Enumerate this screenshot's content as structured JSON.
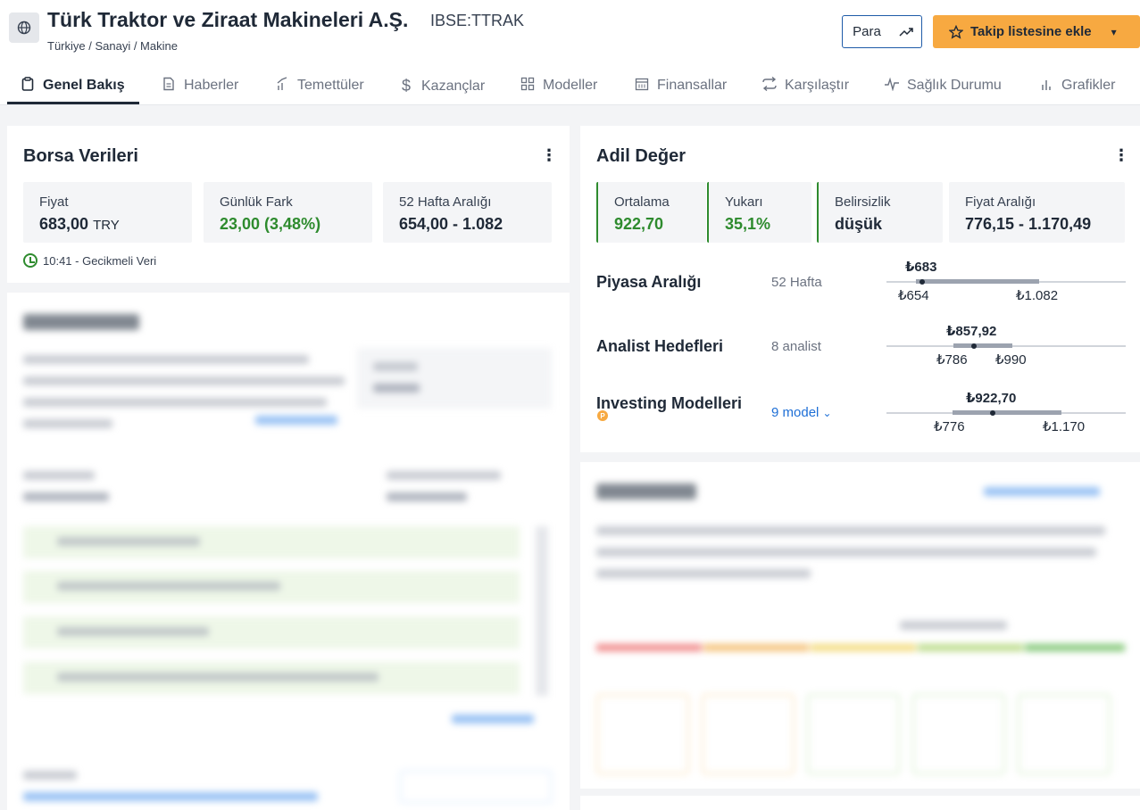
{
  "header": {
    "title": "Türk Traktor ve Ziraat Makineleri A.Ş.",
    "ticker": "IBSE:TTRAK",
    "breadcrumb": "Türkiye / Sanayi / Makine",
    "para_label": "Para",
    "watch_label": "Takip listesine ekle"
  },
  "tabs": [
    {
      "label": "Genel Bakış",
      "icon": "clipboard-icon"
    },
    {
      "label": "Haberler",
      "icon": "document-icon"
    },
    {
      "label": "Temettüler",
      "icon": "growth-icon"
    },
    {
      "label": "Kazançlar",
      "icon": "dollar-icon"
    },
    {
      "label": "Modeller",
      "icon": "grid-icon"
    },
    {
      "label": "Finansallar",
      "icon": "calendar-icon"
    },
    {
      "label": "Karşılaştır",
      "icon": "swap-icon"
    },
    {
      "label": "Sağlık Durumu",
      "icon": "pulse-icon"
    },
    {
      "label": "Grafikler",
      "icon": "bars-icon"
    }
  ],
  "borsa": {
    "title": "Borsa Verileri",
    "price_label": "Fiyat",
    "price_value": "683,00",
    "price_unit": "TRY",
    "change_label": "Günlük Fark",
    "change_value": "23,00 (3,48%)",
    "range_label": "52 Hafta Aralığı",
    "range_value": "654,00 - 1.082",
    "delayed": "10:41 - Gecikmeli Veri"
  },
  "fair": {
    "title": "Adil Değer",
    "avg_label": "Ortalama",
    "avg_value": "922,70",
    "up_label": "Yukarı",
    "up_value": "35,1%",
    "unc_label": "Belirsizlik",
    "unc_value": "düşük",
    "pr_label": "Fiyat Aralığı",
    "pr_value": "776,15 - 1.170,49",
    "rows": [
      {
        "label": "Piyasa Aralığı",
        "sub": "52 Hafta",
        "top": "₺683",
        "low": "₺654",
        "high": "₺1.082"
      },
      {
        "label": "Analist Hedefleri",
        "sub": "8 analist",
        "top": "₺857,92",
        "low": "₺786",
        "high": "₺990"
      },
      {
        "label": "Investing Modelleri",
        "sub": "9 model",
        "top": "₺922,70",
        "low": "₺776",
        "high": "₺1.170"
      }
    ]
  },
  "colors": {
    "accent_orange": "#f7a941",
    "green": "#2e8b2e",
    "link_blue": "#1e6fd6",
    "border_blue": "#1e5ba8"
  }
}
